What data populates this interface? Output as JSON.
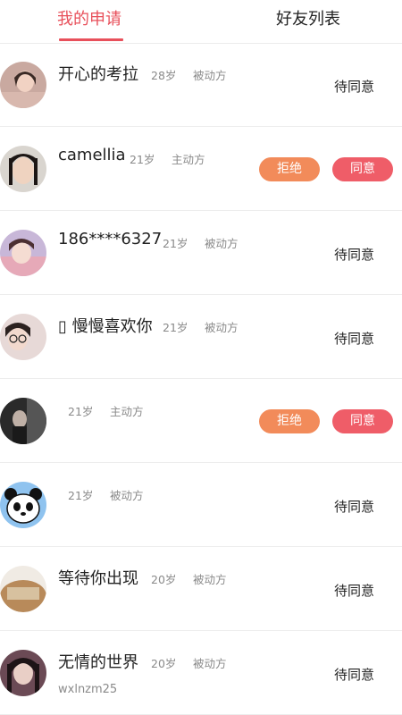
{
  "tabs": [
    {
      "label": "我的申请",
      "active": true
    },
    {
      "label": "好友列表",
      "active": false
    }
  ],
  "colors": {
    "accent": "#e8505b",
    "reject": "#f28b5a",
    "agree": "#ef5d68"
  },
  "items": [
    {
      "name": "开心的考拉",
      "age": "28岁",
      "role": "被动方",
      "sub": "",
      "status": "待同意"
    },
    {
      "name": "camellia",
      "age": "21岁",
      "role": "主动方",
      "sub": "",
      "reject": "拒绝",
      "agree": "同意"
    },
    {
      "name": "186****6327",
      "age": "21岁",
      "role": "被动方",
      "sub": "",
      "status": "待同意"
    },
    {
      "name": "▯ 慢慢喜欢你",
      "age": "21岁",
      "role": "被动方",
      "sub": "",
      "status": "待同意"
    },
    {
      "name": "",
      "age": "21岁",
      "role": "主动方",
      "sub": "",
      "reject": "拒绝",
      "agree": "同意"
    },
    {
      "name": "",
      "age": "21岁",
      "role": "被动方",
      "sub": "",
      "status": "待同意"
    },
    {
      "name": "等待你出现",
      "age": "20岁",
      "role": "被动方",
      "sub": "",
      "status": "待同意"
    },
    {
      "name": "无情的世界",
      "age": "20岁",
      "role": "被动方",
      "sub": "wxlnzm25",
      "status": "待同意"
    }
  ]
}
